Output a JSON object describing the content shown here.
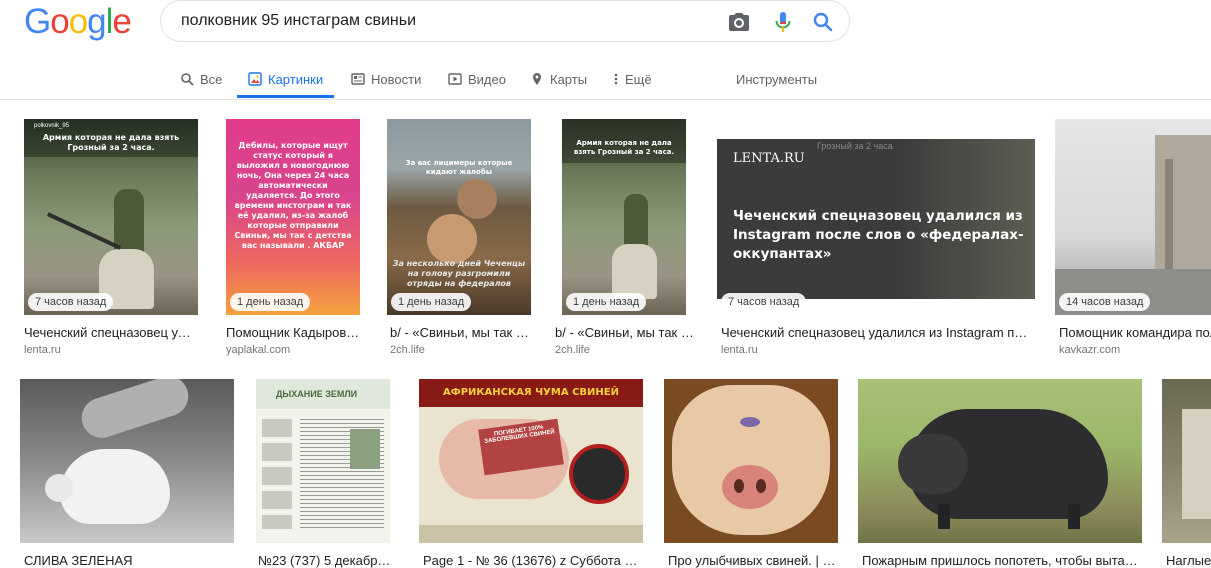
{
  "logo": {
    "text": "Google"
  },
  "search": {
    "query": "полковник 95 инстаграм свиньи"
  },
  "tabs": [
    {
      "label": "Все",
      "icon": "search-icon"
    },
    {
      "label": "Картинки",
      "icon": "image-icon"
    },
    {
      "label": "Новости",
      "icon": "news-icon"
    },
    {
      "label": "Видео",
      "icon": "video-icon"
    },
    {
      "label": "Карты",
      "icon": "map-pin-icon"
    },
    {
      "label": "Ещё",
      "icon": "more-vert-icon"
    }
  ],
  "tools_label": "Инструменты",
  "results_row1": [
    {
      "badge": "7 часов назад",
      "title": "Чеченский спецназовец уда...",
      "source": "lenta.ru",
      "overlay": "Армия которая не дала взять Грозный за 2 часа.",
      "overlay_handle": "polkovnik_95"
    },
    {
      "badge": "1 день назад",
      "title": "Помощник Кадырова:...",
      "source": "yaplakal.com",
      "overlay": "Дебилы, которые ищут статус который я выложил в новогоднюю ночь, Она через 24 часа автоматически удаляется. До этого времени инстограм и так её удалил, из-за жалоб которые отправили Свиньи, мы так с детства вас называли . АКБАР"
    },
    {
      "badge": "1 день назад",
      "title": "b/ - «Свиньи, мы так с...",
      "source": "2ch.life",
      "overlay": "За несколько дней Чеченцы на голову разгромили отряды на федералов",
      "overlay_top": "За вас лицимеры которые кидают жалобы"
    },
    {
      "badge": "1 день назад",
      "title": "b/ - «Свиньи, мы так с...",
      "source": "2ch.life",
      "overlay": "Армия которая не дала взять Грозный за 2 часа."
    },
    {
      "badge": "7 часов назад",
      "title": "Чеченский спецназовец удалился из Instagram пос...",
      "source": "lenta.ru",
      "brand": "LENTA.RU",
      "headline": "Чеченский спецназовец удалился из Instagram после слов о «федералах-оккупантах»",
      "overlay_top": "Грозный за 2 часа"
    },
    {
      "badge": "14 часов назад",
      "title": "Помощник командира пол",
      "source": "kavkazr.com"
    }
  ],
  "results_row2": [
    {
      "title": "СЛИВА ЗЕЛЕНАЯ"
    },
    {
      "title": "№23 (737) 5 декабря ...",
      "overlay": "ДЫХАНИЕ ЗЕМЛИ"
    },
    {
      "title": "Page 1 - № 36 (13676) z Суббота z 1...",
      "overlay": "АФРИКАНСКАЯ ЧУМА СВИНЕЙ",
      "stamp": "ПОГИБАЕТ 100% ЗАБОЛЕВШИХ СВИНЕЙ"
    },
    {
      "title": "Про улыбчивых свиней. | П..."
    },
    {
      "title": "Пожарным пришлось попотеть, чтобы вытащ..."
    },
    {
      "title": "Наглые"
    }
  ],
  "colors": {
    "accent": "#1a73e8",
    "tab_text": "#5f6368",
    "border": "#dfe1e5"
  }
}
